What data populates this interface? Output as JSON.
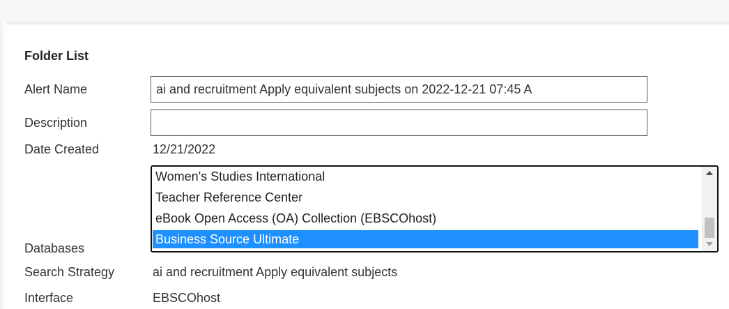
{
  "section": {
    "heading": "Folder List"
  },
  "fields": {
    "alert_name_label": "Alert Name",
    "alert_name_value": "ai and recruitment Apply equivalent subjects on 2022-12-21 07:45 A",
    "description_label": "Description",
    "description_value": "",
    "date_created_label": "Date Created",
    "date_created_value": "12/21/2022",
    "databases_label": "Databases",
    "search_strategy_label": "Search Strategy",
    "search_strategy_value": "ai and recruitment Apply equivalent subjects",
    "interface_label": "Interface",
    "interface_value": "EBSCOhost"
  },
  "databases": {
    "options": [
      "Women's Studies International",
      "Teacher Reference Center",
      "eBook Open Access (OA) Collection (EBSCOhost)",
      "Business Source Ultimate"
    ],
    "selected": "Business Source Ultimate"
  },
  "colors": {
    "selection": "#1e90ff",
    "border": "#555555",
    "text": "#333333"
  },
  "icons": {
    "scroll_up": "scroll-up-arrow-icon",
    "scroll_down": "scroll-down-arrow-icon"
  }
}
